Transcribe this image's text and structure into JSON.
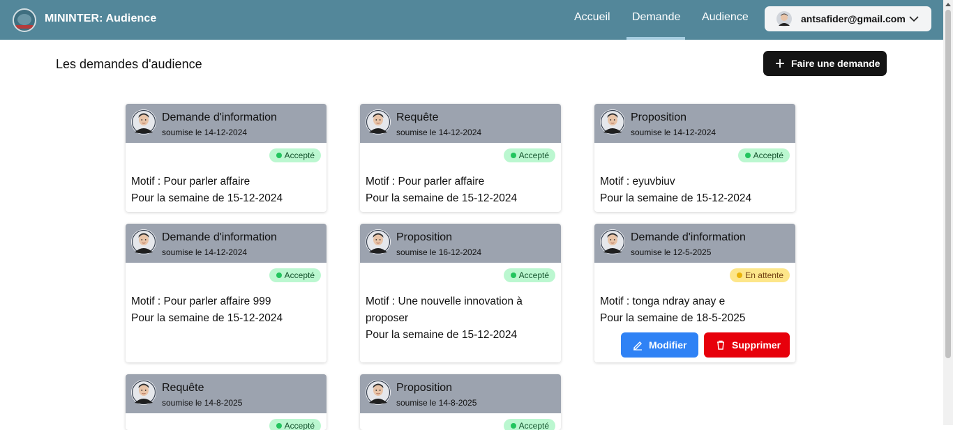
{
  "header": {
    "app_title": "MININTER: Audience",
    "nav": [
      "Accueil",
      "Demande",
      "Audience"
    ],
    "active_nav": "Demande",
    "user_email": "antsafider@gmail.com",
    "logo_icon": "emblem-logo",
    "chevron_icon": "chevron-down-icon"
  },
  "page": {
    "title": "Les demandes d'audience",
    "new_request_label": "Faire une demande",
    "new_request_icon": "plus-icon"
  },
  "cards": [
    {
      "type": "Demande d'information",
      "date": "soumise le 14-12-2024",
      "status": "Accepté",
      "status_kind": "accepted",
      "motif": "Motif : Pour parler affaire",
      "semaine": "Pour la semaine de  15-12-2024"
    },
    {
      "type": "Requête",
      "date": "soumise le 14-12-2024",
      "status": "Accepté",
      "status_kind": "accepted",
      "motif": "Motif : Pour parler affaire",
      "semaine": "Pour la semaine de  15-12-2024"
    },
    {
      "type": "Proposition",
      "date": "soumise le 14-12-2024",
      "status": "Accepté",
      "status_kind": "accepted",
      "motif": "Motif : eyuvbiuv",
      "semaine": "Pour la semaine de  15-12-2024"
    },
    {
      "type": "Demande d'information",
      "date": "soumise le 14-12-2024",
      "status": "Accepté",
      "status_kind": "accepted",
      "motif": "Motif : Pour parler affaire 999",
      "semaine": "Pour la semaine de  15-12-2024"
    },
    {
      "type": "Proposition",
      "date": "soumise le 16-12-2024",
      "status": "Accepté",
      "status_kind": "accepted",
      "motif": "Motif : Une nouvelle innovation à proposer",
      "semaine": "Pour la semaine de  15-12-2024"
    },
    {
      "type": "Demande d'information",
      "date": "soumise le 12-5-2025",
      "status": "En attente",
      "status_kind": "pending",
      "motif": "Motif : tonga ndray anay e",
      "semaine": "Pour la semaine de  18-5-2025",
      "actions": {
        "edit": "Modifier",
        "delete": "Supprimer"
      }
    },
    {
      "type": "Requête",
      "date": "soumise le 14-8-2025",
      "status": "Accepté",
      "status_kind": "accepted"
    },
    {
      "type": "Proposition",
      "date": "soumise le 14-8-2025",
      "status": "Accepté",
      "status_kind": "accepted"
    }
  ],
  "colors": {
    "navbar": "#53879a",
    "card_header": "#9ca3af",
    "accepted_badge": "#bbf7d0",
    "pending_badge": "#fde68a",
    "primary_button": "#141414",
    "edit_button": "#2f82f5",
    "delete_button": "#e7000b"
  }
}
